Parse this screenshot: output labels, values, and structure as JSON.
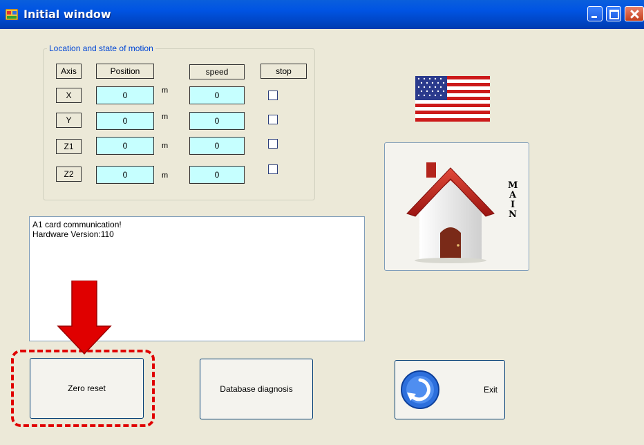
{
  "window": {
    "title": "Initial window"
  },
  "group": {
    "title": "Location and state of motion",
    "headers": {
      "axis": "Axis",
      "position": "Position",
      "speed": "speed",
      "stop": "stop"
    },
    "rows": [
      {
        "axis": "X",
        "position": "0",
        "unit": "m",
        "speed": "0",
        "stop": false
      },
      {
        "axis": "Y",
        "position": "0",
        "unit": "m",
        "speed": "0",
        "stop": false
      },
      {
        "axis": "Z1",
        "position": "0",
        "unit": "m",
        "speed": "0",
        "stop": false
      },
      {
        "axis": "Z2",
        "position": "0",
        "unit": "m",
        "speed": "0",
        "stop": false
      }
    ]
  },
  "log": {
    "line1": "A1 card communication!",
    "line2": "Hardware Version:110"
  },
  "main_button": {
    "letters": [
      "M",
      "A",
      "I",
      "N"
    ],
    "icon": "house-icon"
  },
  "language": {
    "icon": "us-flag-icon"
  },
  "buttons": {
    "zero_reset": "Zero reset",
    "database_diagnosis": "Database diagnosis",
    "exit": "Exit"
  },
  "annotation": {
    "arrow_color": "#e00000",
    "highlight_color": "#e00000"
  }
}
